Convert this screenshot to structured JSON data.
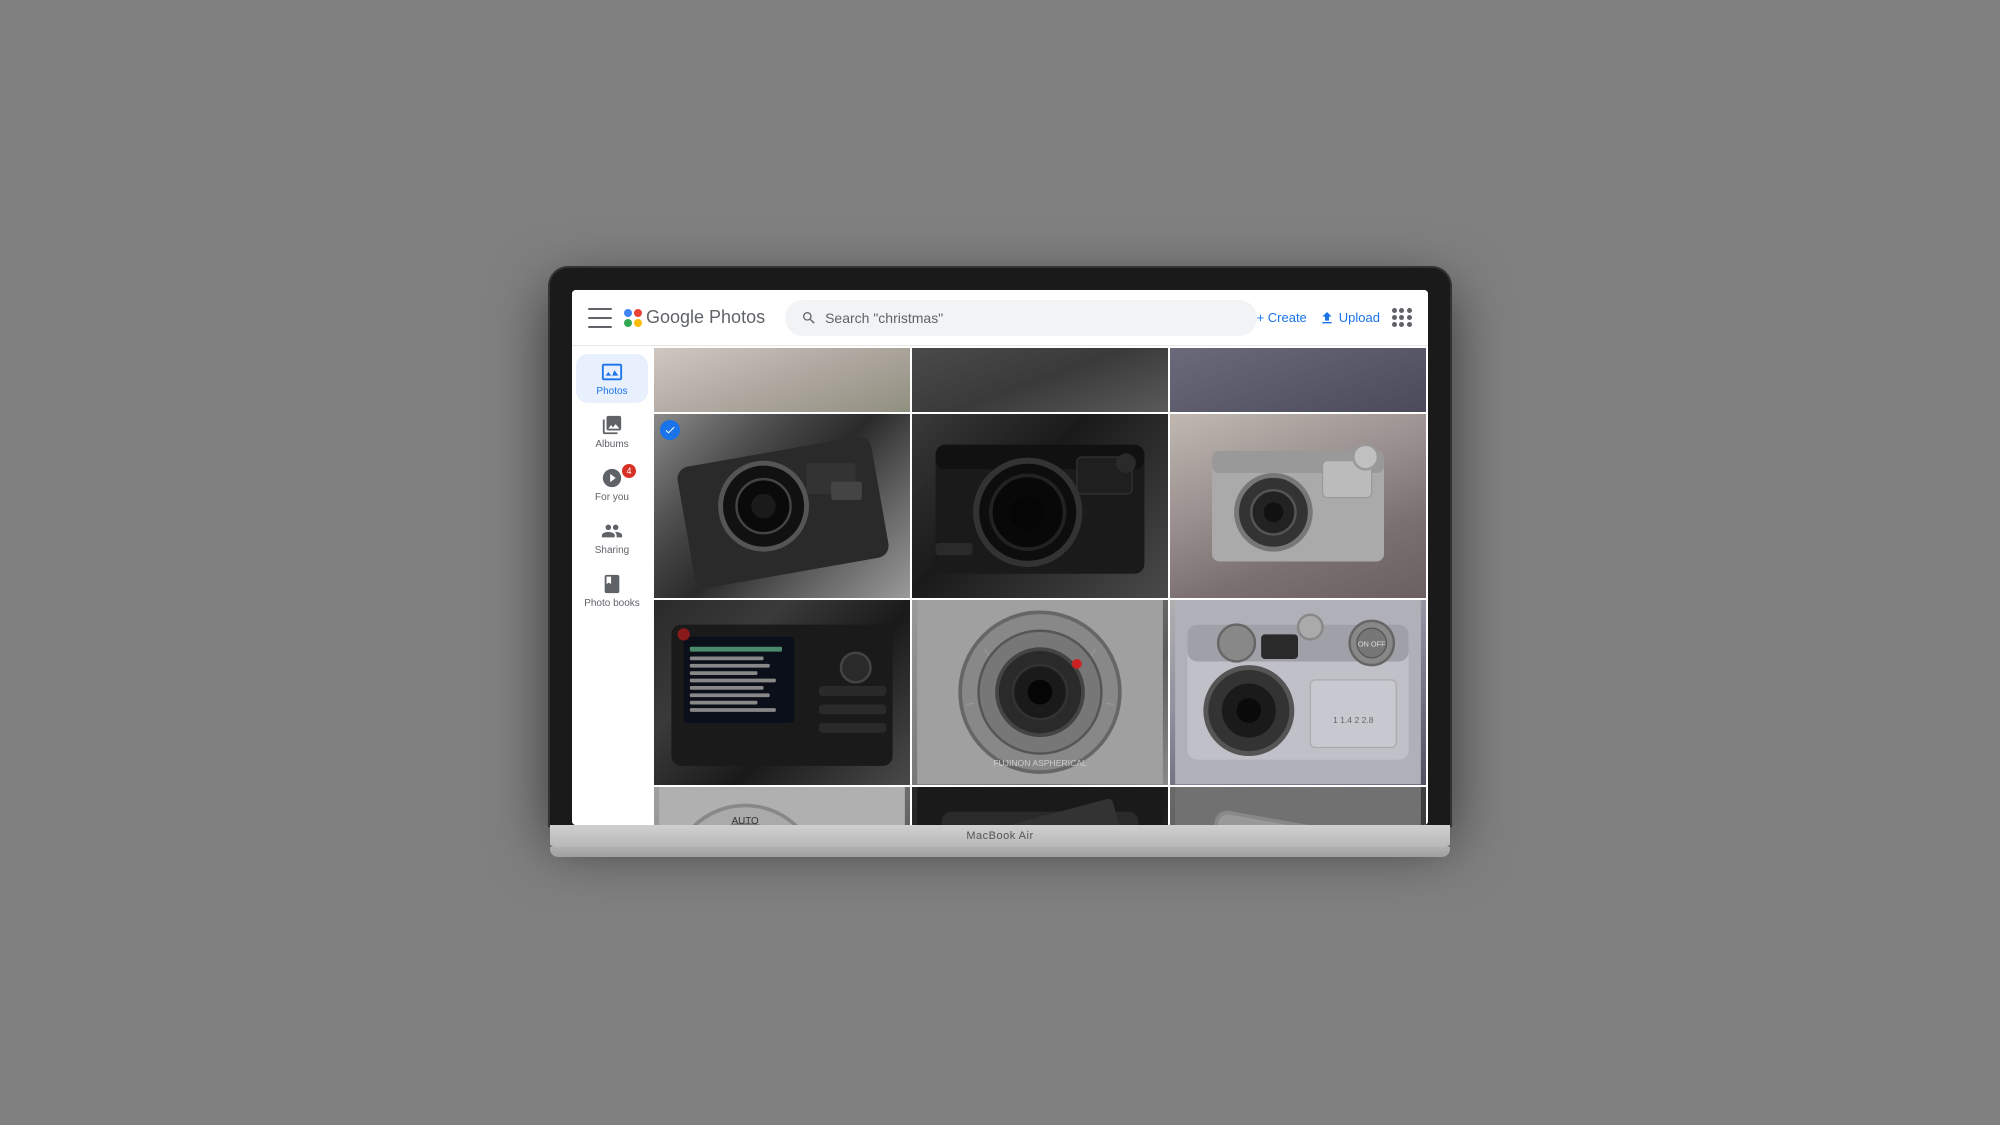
{
  "app": {
    "title": "Google Photos"
  },
  "header": {
    "menu_label": "Menu",
    "logo_text": "Photos",
    "search_placeholder": "Search \"christmas\"",
    "create_label": "+ Create",
    "upload_label": "Upload",
    "apps_label": "Google apps"
  },
  "sidebar": {
    "items": [
      {
        "id": "photos",
        "label": "Photos",
        "active": true,
        "badge": null
      },
      {
        "id": "albums",
        "label": "Albums",
        "active": false,
        "badge": null
      },
      {
        "id": "for-you",
        "label": "For you",
        "active": false,
        "badge": "4"
      },
      {
        "id": "sharing",
        "label": "Sharing",
        "active": false,
        "badge": null
      },
      {
        "id": "photo-books",
        "label": "Photo books",
        "active": false,
        "badge": null
      }
    ]
  },
  "grid": {
    "photos": [
      {
        "id": 1,
        "alt": "Camera top view diagonal",
        "selected": true
      },
      {
        "id": 2,
        "alt": "Camera front view black",
        "selected": false
      },
      {
        "id": 3,
        "alt": "Camera side view silver",
        "selected": false
      },
      {
        "id": 4,
        "alt": "Camera back view menu",
        "selected": false
      },
      {
        "id": 5,
        "alt": "Camera lens close up silver",
        "selected": false
      },
      {
        "id": 6,
        "alt": "Camera top view silver dials",
        "selected": false
      },
      {
        "id": 7,
        "alt": "Camera top view dials on/off",
        "selected": false
      },
      {
        "id": 8,
        "alt": "Camera battery compartment",
        "selected": false
      },
      {
        "id": 9,
        "alt": "Camera overhead view",
        "selected": false
      }
    ]
  },
  "macbook": {
    "label": "MacBook Air"
  },
  "colors": {
    "accent_blue": "#1a73e8",
    "text_primary": "#202124",
    "text_secondary": "#5f6368",
    "bg_sidebar_active": "#e8f0fe",
    "badge_red": "#d93025"
  }
}
